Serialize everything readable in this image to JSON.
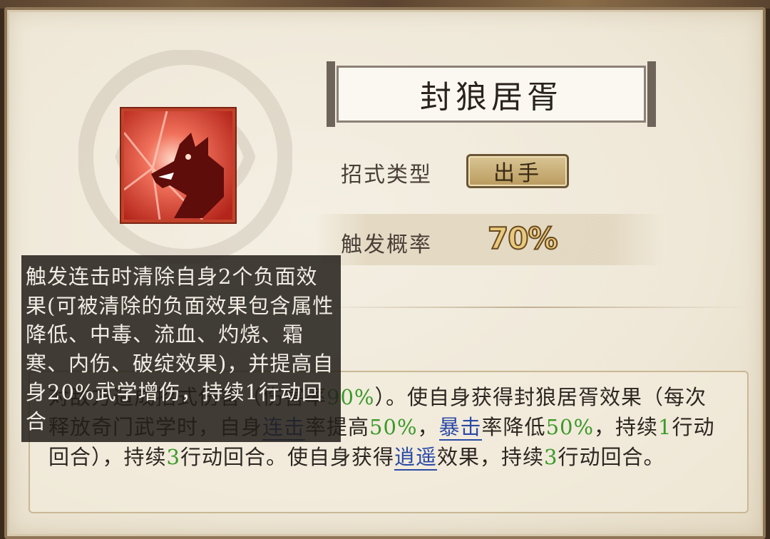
{
  "skill": {
    "name": "封狼居胥",
    "type_label": "招式类型",
    "type_value": "出手",
    "rate_label": "触发概率",
    "rate_value": "70%"
  },
  "description": {
    "segments": [
      {
        "text": "对敌方造成招式伤害（伤害率",
        "style": "normal"
      },
      {
        "text": "90%",
        "style": "green"
      },
      {
        "text": "）。使自身获得封狼居胥效果（每次释放奇门武学时，自身",
        "style": "normal"
      },
      {
        "text": "连击",
        "style": "keyword"
      },
      {
        "text": "率提高",
        "style": "normal"
      },
      {
        "text": "50%",
        "style": "green"
      },
      {
        "text": "，",
        "style": "normal"
      },
      {
        "text": "暴击",
        "style": "keyword"
      },
      {
        "text": "率降低",
        "style": "normal"
      },
      {
        "text": "50%",
        "style": "green"
      },
      {
        "text": "，持续",
        "style": "normal"
      },
      {
        "text": "1",
        "style": "green"
      },
      {
        "text": "行动回合），持续",
        "style": "normal"
      },
      {
        "text": "3",
        "style": "green"
      },
      {
        "text": "行动回合。使自身获得",
        "style": "normal"
      },
      {
        "text": "逍遥",
        "style": "keyword"
      },
      {
        "text": "效果，持续",
        "style": "normal"
      },
      {
        "text": "3",
        "style": "green"
      },
      {
        "text": "行动回合。",
        "style": "normal"
      }
    ]
  },
  "tooltip": {
    "text": "触发连击时清除自身2个负面效果(可被清除的负面效果包含属性降低、中毒、流血、灼烧、霜寒、内伤、破绽效果)，并提高自身20%武学增伤，持续1行动回合"
  },
  "icons": {
    "skill_icon": "wolf-head-icon",
    "emblem": "cloud-emblem"
  },
  "colors": {
    "accent_green": "#3b9a2a",
    "keyword_blue": "#2b4aa6",
    "icon_red": "#e24e2f"
  }
}
